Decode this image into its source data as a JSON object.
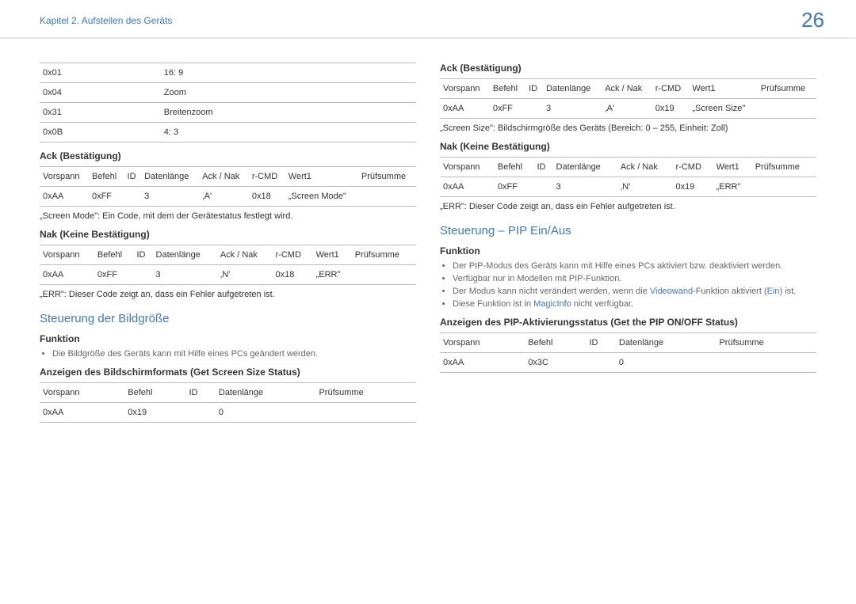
{
  "header": {
    "chapter": "Kapitel 2. Aufstellen des Geräts",
    "page": "26"
  },
  "left": {
    "modes": {
      "rows": [
        {
          "code": "0x01",
          "label": "16: 9"
        },
        {
          "code": "0x04",
          "label": "Zoom"
        },
        {
          "code": "0x31",
          "label": "Breitenzoom"
        },
        {
          "code": "0x0B",
          "label": "4: 3"
        }
      ]
    },
    "ack": {
      "title": "Ack (Bestätigung)",
      "headers": [
        "Vorspann",
        "Befehl",
        "ID",
        "Datenlänge",
        "Ack / Nak",
        "r-CMD",
        "Wert1",
        "Prüfsumme"
      ],
      "row": [
        "0xAA",
        "0xFF",
        "",
        "3",
        "‚A'",
        "0x18",
        "„Screen Mode\"",
        ""
      ],
      "note": "„Screen Mode\": Ein Code, mit dem der Gerätestatus festlegt wird."
    },
    "nak": {
      "title": "Nak (Keine Bestätigung)",
      "headers": [
        "Vorspann",
        "Befehl",
        "ID",
        "Datenlänge",
        "Ack / Nak",
        "r-CMD",
        "Wert1",
        "Prüfsumme"
      ],
      "row": [
        "0xAA",
        "0xFF",
        "",
        "3",
        "‚N'",
        "0x18",
        "„ERR\"",
        ""
      ],
      "note": "„ERR\": Dieser Code zeigt an, dass ein Fehler aufgetreten ist."
    },
    "sizeControl": {
      "title": "Steuerung der Bildgröße",
      "funktion": "Funktion",
      "bullet": "Die Bildgröße des Geräts kann mit Hilfe eines PCs geändert werden.",
      "getTitle": "Anzeigen des Bildschirmformats (Get Screen Size Status)",
      "headers": [
        "Vorspann",
        "Befehl",
        "ID",
        "Datenlänge",
        "Prüfsumme"
      ],
      "row": [
        "0xAA",
        "0x19",
        "",
        "0",
        ""
      ]
    }
  },
  "right": {
    "ack": {
      "title": "Ack (Bestätigung)",
      "headers": [
        "Vorspann",
        "Befehl",
        "ID",
        "Datenlänge",
        "Ack / Nak",
        "r-CMD",
        "Wert1",
        "Prüfsumme"
      ],
      "row": [
        "0xAA",
        "0xFF",
        "",
        "3",
        "‚A'",
        "0x19",
        "„Screen Size\"",
        ""
      ],
      "note": "„Screen Size\": Bildschirmgröße des Geräts (Bereich: 0 – 255, Einheit: Zoll)"
    },
    "nak": {
      "title": "Nak (Keine Bestätigung)",
      "headers": [
        "Vorspann",
        "Befehl",
        "ID",
        "Datenlänge",
        "Ack / Nak",
        "r-CMD",
        "Wert1",
        "Prüfsumme"
      ],
      "row": [
        "0xAA",
        "0xFF",
        "",
        "3",
        "‚N'",
        "0x19",
        "„ERR\"",
        ""
      ],
      "note": "„ERR\": Dieser Code zeigt an, dass ein Fehler aufgetreten ist."
    },
    "pip": {
      "title": "Steuerung – PIP Ein/Aus",
      "funktion": "Funktion",
      "bullets": {
        "b1": "Der PIP-Modus des Geräts kann mit Hilfe eines PCs aktiviert bzw. deaktiviert werden.",
        "b2": "Verfügbar nur in Modellen mit PIP-Funktion.",
        "b3a": "Der Modus kann nicht verändert werden, wenn die ",
        "b3link1": "Videowand",
        "b3b": "-Funktion aktiviert (",
        "b3link2": "Ein",
        "b3c": ") ist.",
        "b4a": "Diese Funktion ist in ",
        "b4link": "MagicInfo",
        "b4b": " nicht verfügbar."
      },
      "getTitle": "Anzeigen des PIP-Aktivierungsstatus (Get the PIP ON/OFF Status)",
      "headers": [
        "Vorspann",
        "Befehl",
        "ID",
        "Datenlänge",
        "Prüfsumme"
      ],
      "row": [
        "0xAA",
        "0x3C",
        "",
        "0",
        ""
      ]
    }
  }
}
